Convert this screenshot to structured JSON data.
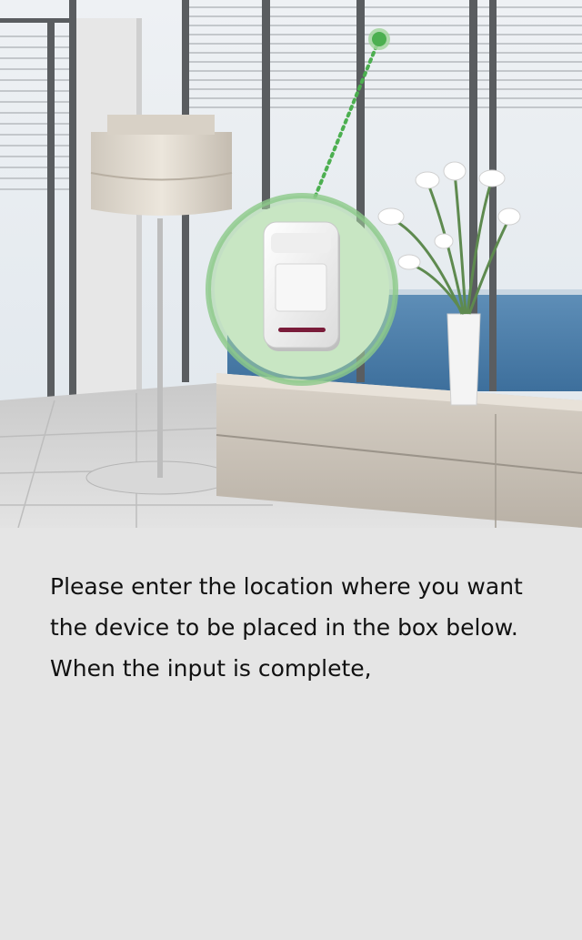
{
  "hero": {
    "image_name": "room-scene-with-motion-sensor",
    "marker_color": "#4caf50",
    "highlight_color": "#a5d6a0"
  },
  "content": {
    "instruction": "Please enter the location where you want the device to be placed in the box below. When the input is complete,"
  }
}
